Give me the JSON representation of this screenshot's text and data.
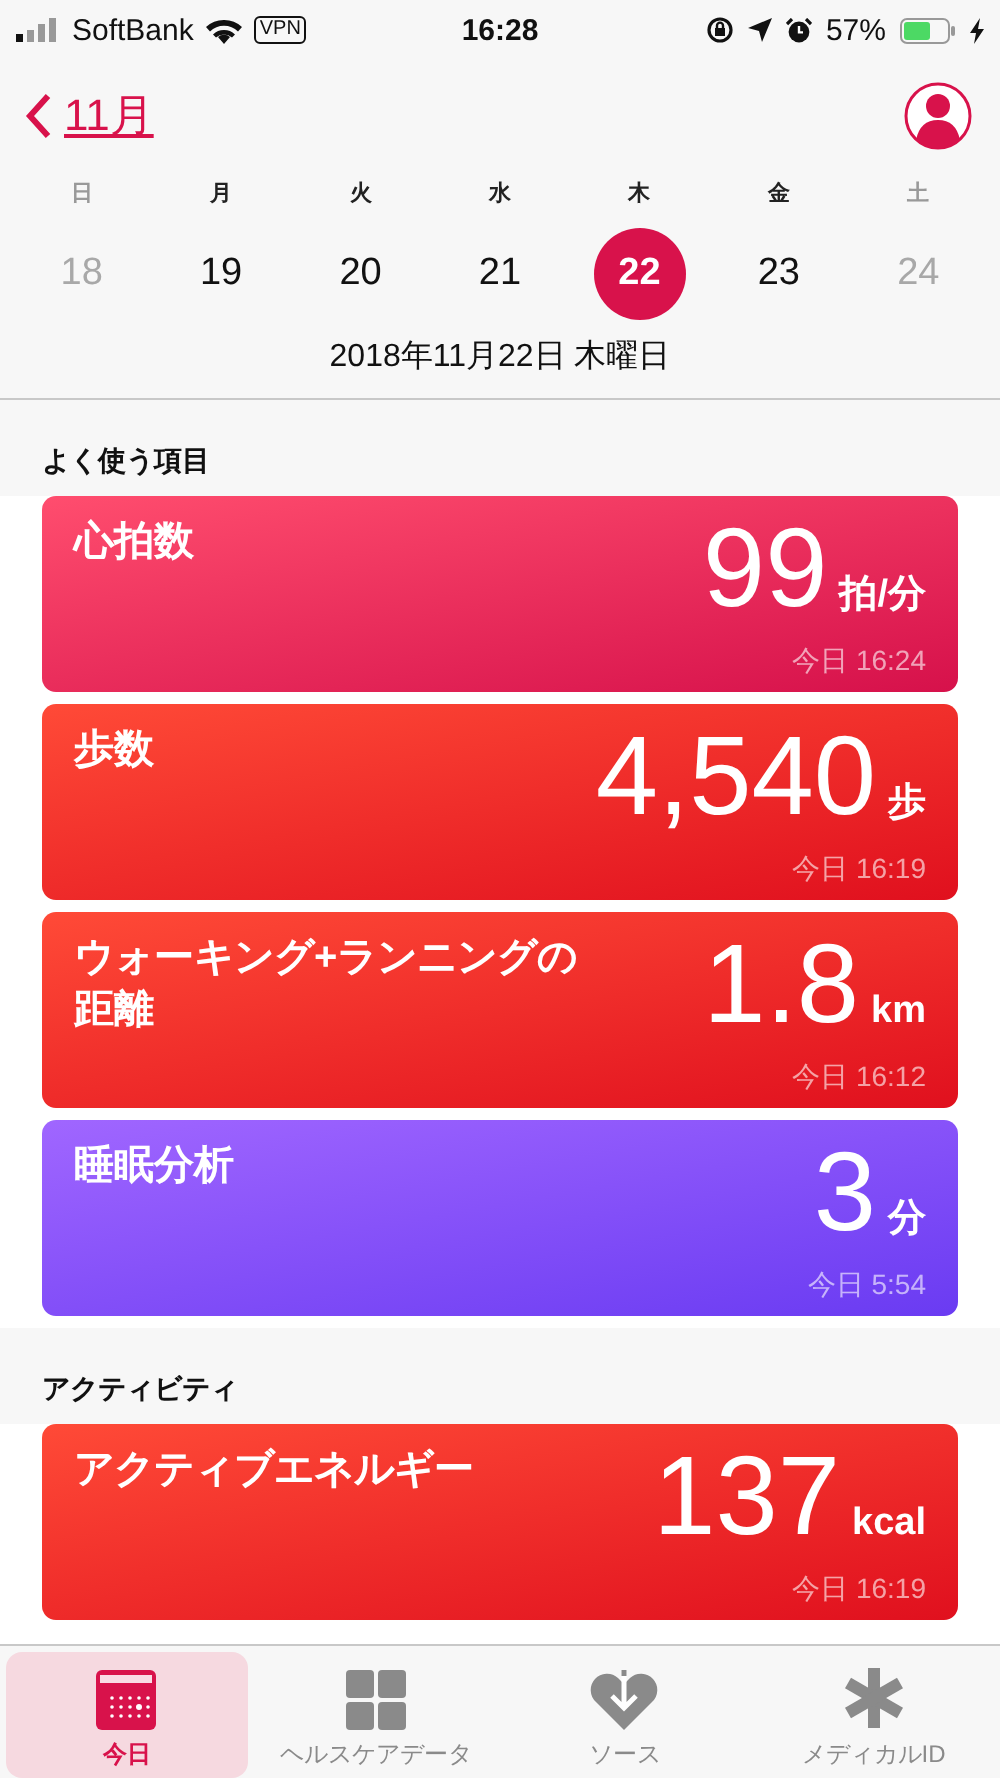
{
  "status_bar": {
    "carrier": "SoftBank",
    "vpn": "VPN",
    "time": "16:28",
    "battery": "57%"
  },
  "header": {
    "back_label": "11月"
  },
  "week": [
    {
      "weekday": "日",
      "day": "18",
      "muted": true,
      "selected": false
    },
    {
      "weekday": "月",
      "day": "19",
      "muted": false,
      "selected": false
    },
    {
      "weekday": "火",
      "day": "20",
      "muted": false,
      "selected": false
    },
    {
      "weekday": "水",
      "day": "21",
      "muted": false,
      "selected": false
    },
    {
      "weekday": "木",
      "day": "22",
      "muted": false,
      "selected": true
    },
    {
      "weekday": "金",
      "day": "23",
      "muted": false,
      "selected": false
    },
    {
      "weekday": "土",
      "day": "24",
      "muted": true,
      "selected": false
    }
  ],
  "date_line": "2018年11月22日 木曜日",
  "sections": [
    {
      "title": "よく使う項目",
      "cards": [
        {
          "kind": "heart",
          "title": "心拍数",
          "value": "99",
          "unit": "拍/分",
          "time": "今日 16:24"
        },
        {
          "kind": "red",
          "title": "歩数",
          "value": "4,540",
          "unit": "歩",
          "time": "今日 16:19"
        },
        {
          "kind": "red",
          "title": "ウォーキング+ランニングの距離",
          "value": "1.8",
          "unit": "km",
          "time": "今日 16:12"
        },
        {
          "kind": "sleep",
          "title": "睡眠分析",
          "value": "3",
          "unit": "分",
          "time": "今日 5:54"
        }
      ]
    },
    {
      "title": "アクティビティ",
      "cards": [
        {
          "kind": "red",
          "title": "アクティブエネルギー",
          "value": "137",
          "unit": "kcal",
          "time": "今日 16:19"
        }
      ]
    }
  ],
  "tab_bar": [
    {
      "kind": "calendar",
      "label": "今日",
      "selected": true
    },
    {
      "kind": "grid",
      "label": "ヘルスケアデータ",
      "selected": false
    },
    {
      "kind": "source",
      "label": "ソース",
      "selected": false
    },
    {
      "kind": "medical",
      "label": "メディカルID",
      "selected": false
    }
  ]
}
